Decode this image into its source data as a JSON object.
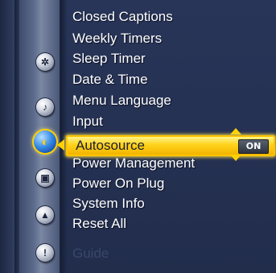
{
  "menu": {
    "items": [
      {
        "label": "Closed Captions"
      },
      {
        "label": "Weekly Timers"
      },
      {
        "label": "Sleep Timer"
      },
      {
        "label": "Date & Time"
      },
      {
        "label": "Menu Language"
      },
      {
        "label": "Input"
      },
      {
        "label": "Autosource",
        "value": "ON",
        "selected": true
      },
      {
        "label": "Power Management"
      },
      {
        "label": "Power On Plug"
      },
      {
        "label": "System Info"
      },
      {
        "label": "Reset All"
      },
      {
        "label": "Guide"
      }
    ]
  },
  "icons": [
    {
      "name": "settings-icon",
      "glyph": "✲"
    },
    {
      "name": "audio-icon",
      "glyph": "♪"
    },
    {
      "name": "setup-icon",
      "glyph": "◐",
      "active": true
    },
    {
      "name": "tv-icon",
      "glyph": "▣"
    },
    {
      "name": "lock-icon",
      "glyph": "▲"
    },
    {
      "name": "info-icon",
      "glyph": "!"
    }
  ],
  "colors": {
    "highlight": "#ffd21a",
    "panel": "#263254",
    "text": "#ffffff"
  }
}
